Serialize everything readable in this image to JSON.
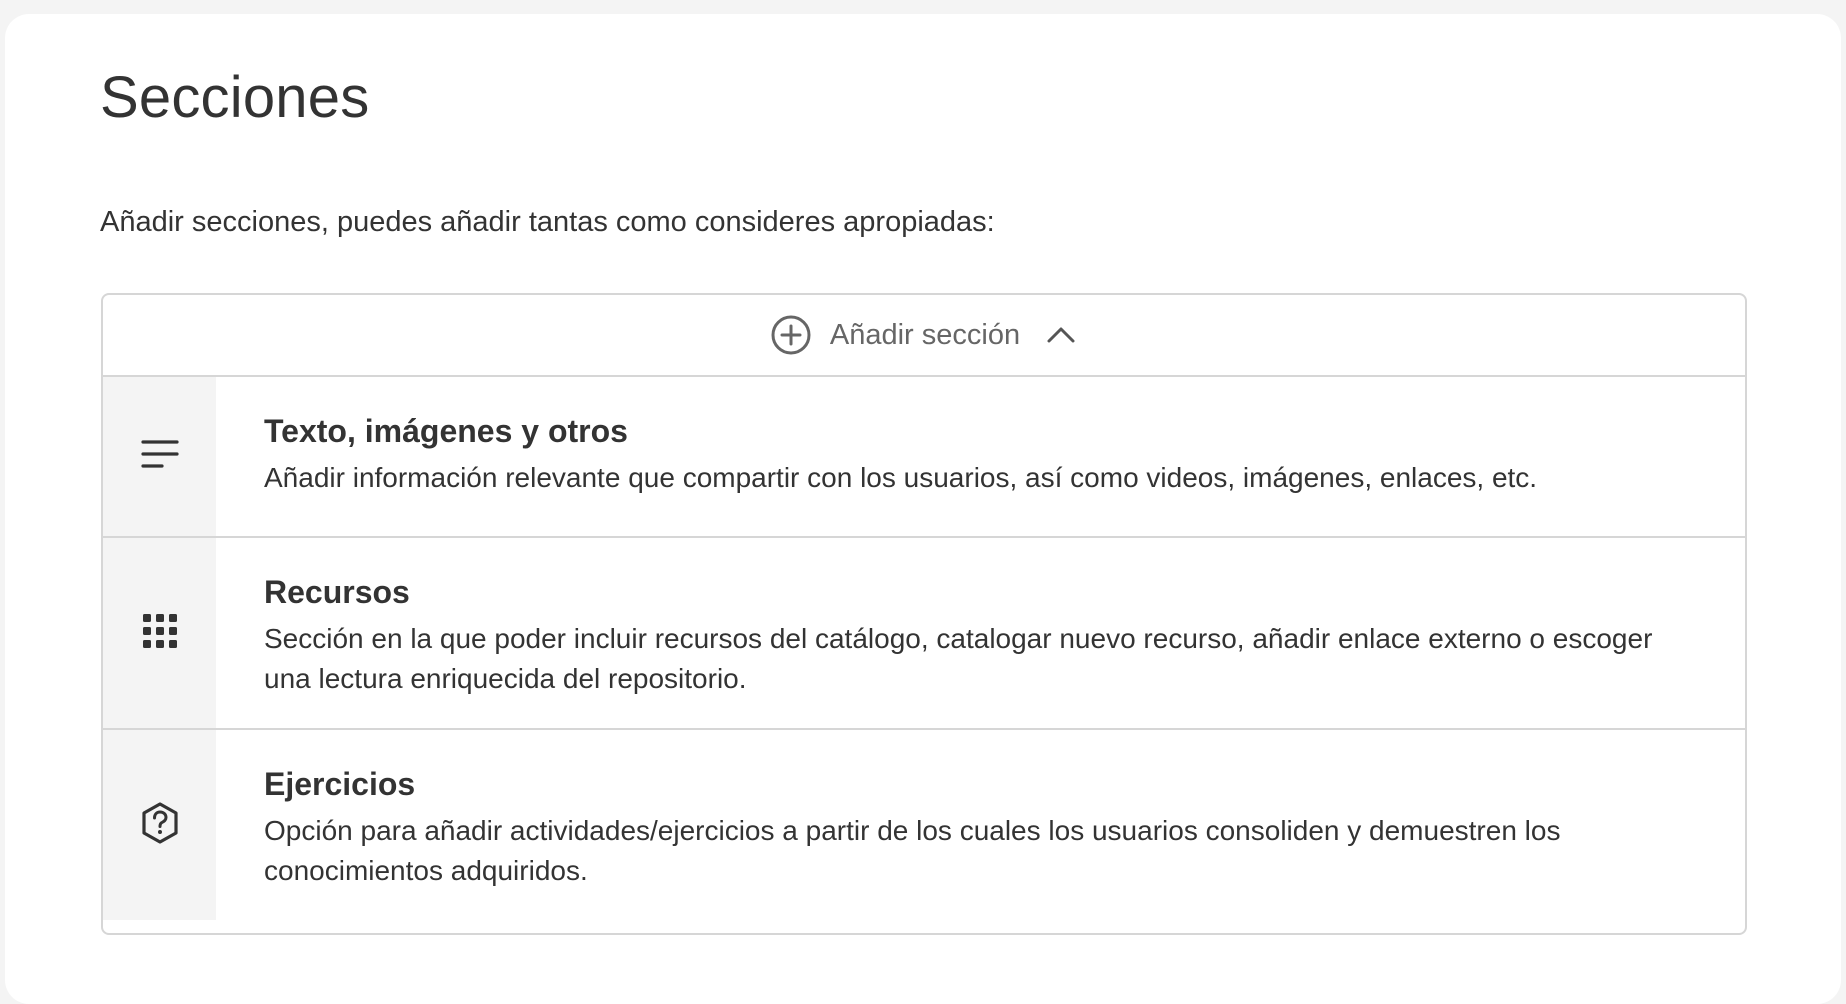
{
  "page": {
    "title": "Secciones",
    "intro": "Añadir secciones, puedes añadir tantas como consideres apropiadas:"
  },
  "add_section": {
    "label": "Añadir sección",
    "icon": "plus-circle-icon",
    "toggle_icon": "chevron-up-icon",
    "expanded": true
  },
  "options": [
    {
      "icon": "text-lines-icon",
      "title": "Texto, imágenes y otros",
      "description": "Añadir información relevante que compartir con los usuarios, así como videos, imágenes, enlaces, etc."
    },
    {
      "icon": "grid-dots-icon",
      "title": "Recursos",
      "description": "Sección en la que poder incluir recursos del catálogo, catalogar nuevo recurso, añadir enlace externo o escoger una lectura enriquecida del repositorio."
    },
    {
      "icon": "question-hexagon-icon",
      "title": "Ejercicios",
      "description": "Opción para añadir actividades/ejercicios a partir de los cuales los usuarios consoliden y demuestren los conocimientos adquiridos."
    }
  ],
  "colors": {
    "background": "#f4f4f4",
    "card": "#ffffff",
    "border": "#d6d6d6",
    "text": "#333333",
    "muted_text": "#666666"
  }
}
